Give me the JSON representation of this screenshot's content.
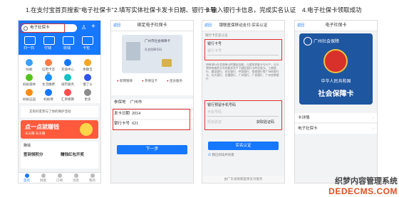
{
  "captions": [
    "1.在支付宝首页搜索“电子社保卡”",
    "2.填写实体社保卡发卡日期、银行卡号",
    "3.输入银行卡信息，完成实名认证",
    "4.电子社保卡领取成功"
  ],
  "p1": {
    "search": "电子社保卡",
    "top_items": [
      "扫一扫",
      "付钱",
      "收钱",
      "卡包"
    ],
    "grid": [
      "蚂蚁",
      "信用卡还款",
      "充值中心",
      "余额宝",
      "蚂蚁森林",
      "生活缴费",
      "城市服务",
      "饿了么",
      "蚂蚁庄园",
      "蚂蚁保",
      "汇率换算",
      "更多"
    ],
    "notice": "又有好友参与了你的保护活动",
    "banner_title": "点一点就赚钱",
    "banner_sub": "天天赚 天天赚",
    "section": "赚钱",
    "card1": "签到领积分",
    "card2": "赚钱红包开奖",
    "tabs": [
      "首页",
      "财富",
      "口碑",
      "消息",
      "我的"
    ]
  },
  "p2": {
    "back": "返回",
    "title": "绑定电子社保卡",
    "card_city": "广州市社会保障卡",
    "card_name_label": "社会保障号码",
    "chips": [
      "新网银保",
      "参保证卡",
      "团员服务"
    ],
    "rows": [
      {
        "k": "参保地",
        "v": "广州市"
      },
      {
        "k": "发卡日期",
        "v": "2014"
      },
      {
        "k": "银行卡号",
        "v": "621"
      }
    ],
    "submit": "下一步"
  },
  "p3": {
    "back": "返回",
    "title": "银联医保移动支付-实名认证",
    "sub": "银行卡实名认证",
    "h1": "银行卡号",
    "ph1": "银行卡号",
    "desc": "持有银行社会保障卡的兼容功能，可使用你要卡号开户，可以将持有者的卡号的要求开户下绑定银行卡的社保卡。工商银行、建设银行、农业银行、中国银行、招商银行等广州的银行卡，光大银行、交通银行、广州银行、广发银行、广州农商银行",
    "h2": "银行预留手机号码",
    "ph2": "手机号码",
    "ph3": "短信验证",
    "getcode": "获取验证码",
    "submit": "实名认证",
    "agree": "我已阅读并同意",
    "footer": "由广东省银联医保支付服务"
  },
  "p4": {
    "back": "返回",
    "title": "电子社保卡",
    "card_title": "广州社会保障",
    "card_cn": "中华人民共和国",
    "card_big": "社会保障卡",
    "r1": "卡详情",
    "r2": "电子社保卡"
  },
  "watermark": {
    "line1": "织梦内容管理系统",
    "line2": "DEDECMS.COM"
  }
}
